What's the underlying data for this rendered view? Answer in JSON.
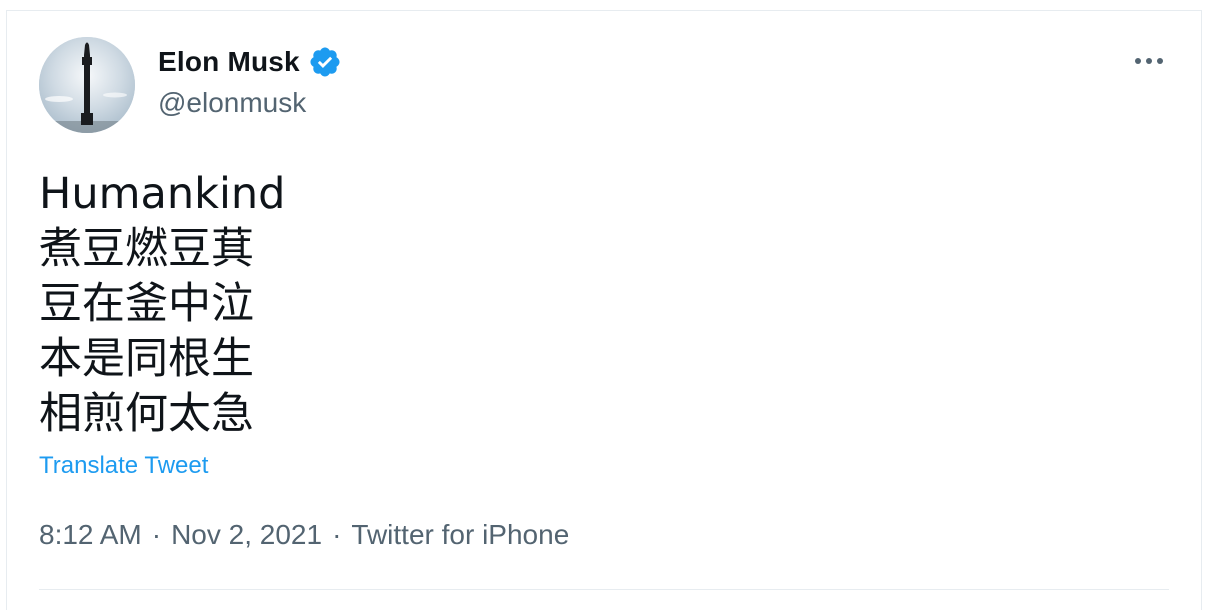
{
  "tweet": {
    "author": {
      "name": "Elon Musk",
      "handle": "@elonmusk",
      "verified": true,
      "avatar_icon": "rocket-starship-avatar"
    },
    "lines": [
      "Humankind",
      "煮豆燃豆萁",
      "豆在釜中泣",
      "本是同根生",
      "相煎何太急"
    ],
    "translate_label": "Translate Tweet",
    "time": "8:12 AM",
    "date": "Nov 2, 2021",
    "source": "Twitter for iPhone",
    "separator": "·"
  },
  "colors": {
    "accent": "#1d9bf0",
    "text_primary": "#0f1419",
    "text_secondary": "#536471",
    "border": "#e7ecf0"
  }
}
